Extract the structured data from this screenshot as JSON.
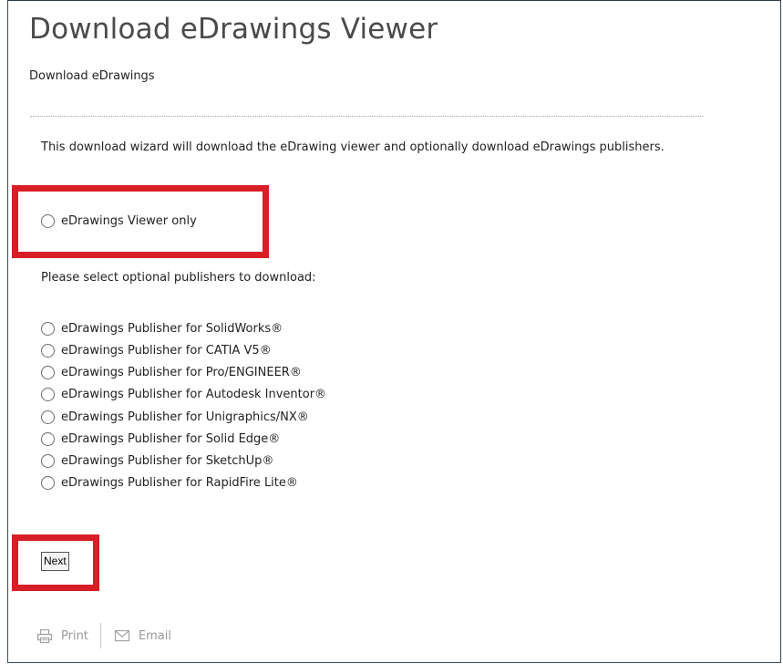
{
  "page": {
    "title": "Download eDrawings Viewer",
    "subtitle": "Download eDrawings",
    "intro": "This download wizard will download the eDrawing viewer and optionally download eDrawings publishers."
  },
  "options": {
    "viewer_only_label": "eDrawings Viewer only",
    "publishers_prompt": "Please select optional publishers to download:",
    "publishers": [
      "eDrawings Publisher for SolidWorks®",
      "eDrawings Publisher for CATIA V5®",
      "eDrawings Publisher for Pro/ENGINEER®",
      "eDrawings Publisher for Autodesk Inventor®",
      "eDrawings Publisher for Unigraphics/NX®",
      "eDrawings Publisher for Solid Edge®",
      "eDrawings Publisher for SketchUp®",
      "eDrawings Publisher for RapidFire Lite®"
    ]
  },
  "actions": {
    "next_label": "Next",
    "print_label": "Print",
    "email_label": "Email"
  },
  "colors": {
    "highlight": "#d81e26",
    "title": "#4a4a4a",
    "muted": "#9a9a9a"
  },
  "icons": {
    "print": "printer-icon",
    "email": "envelope-icon",
    "radio": "radio-button-icon"
  }
}
